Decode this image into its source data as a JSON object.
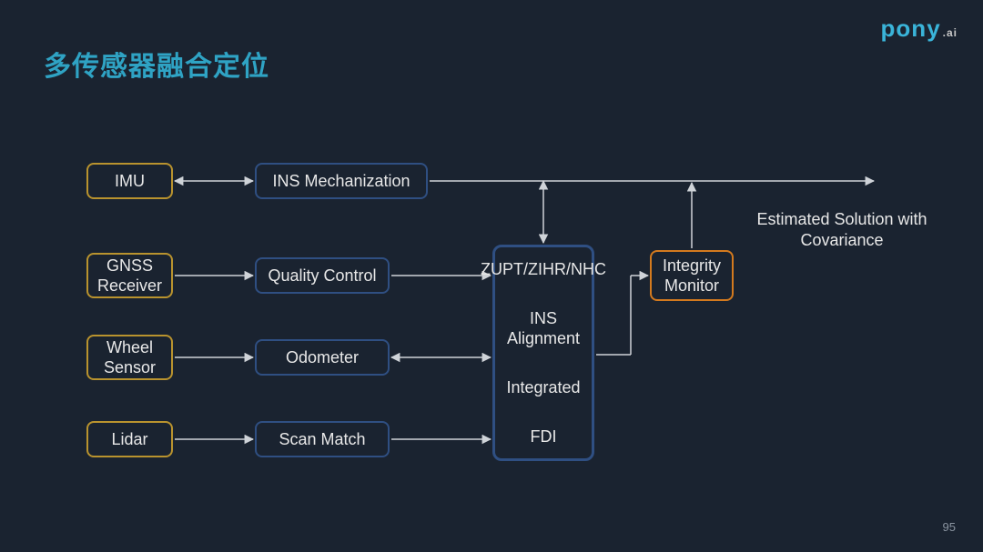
{
  "title": "多传感器融合定位",
  "logo": {
    "brand": "pony",
    "suffix": ".ai"
  },
  "page_number": "95",
  "sensors": {
    "imu": "IMU",
    "gnss": "GNSS Receiver",
    "wheel": "Wheel Sensor",
    "lidar": "Lidar"
  },
  "processors": {
    "ins_mech": "INS Mechanization",
    "quality": "Quality Control",
    "odometer": "Odometer",
    "scan": "Scan Match"
  },
  "fusion": {
    "line1": "ZUPT/ZIHR/NHC",
    "line2": "INS Alignment",
    "line3": "Integrated",
    "line4": "FDI"
  },
  "integrity": "Integrity Monitor",
  "output": "Estimated Solution with Covariance"
}
